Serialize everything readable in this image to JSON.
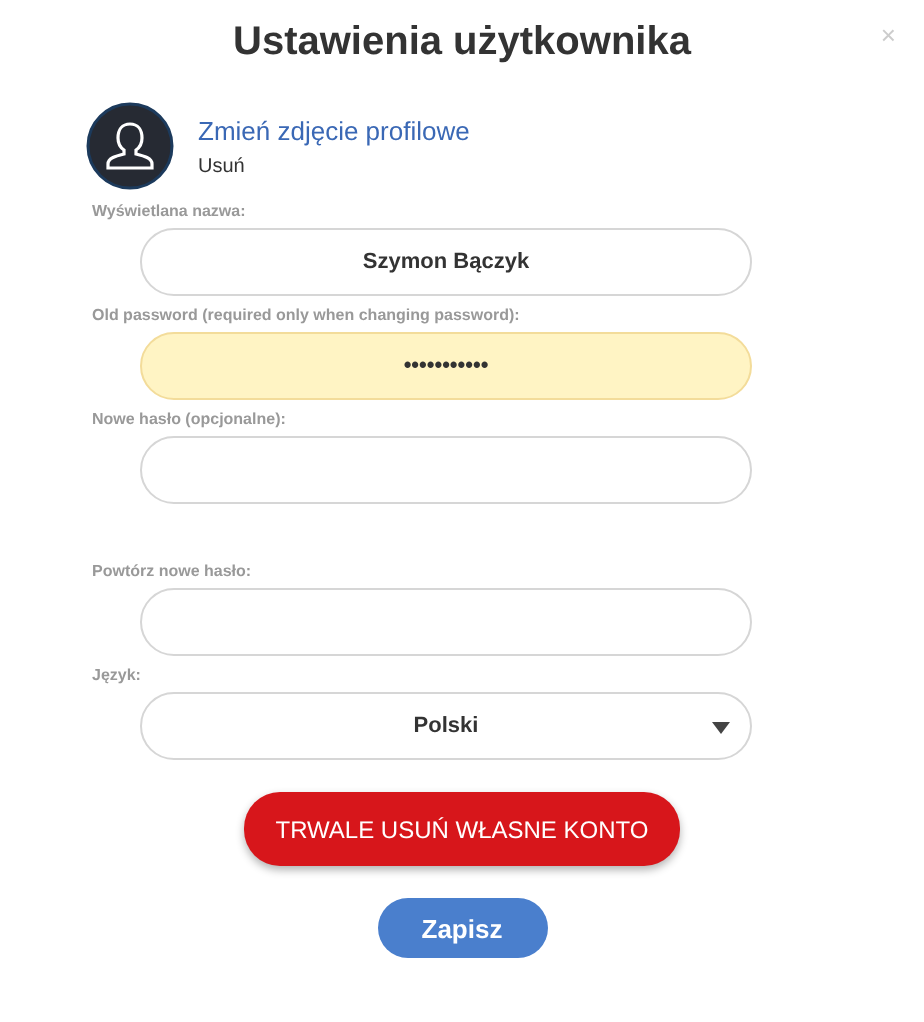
{
  "dialog": {
    "title": "Ustawienia użytkownika",
    "close": "×"
  },
  "profile": {
    "change_photo": "Zmień zdjęcie profilowe",
    "remove": "Usuń"
  },
  "fields": [
    {
      "kind": "text",
      "label": "Wyświetlana nazwa:",
      "value": "Szymon Bączyk",
      "autofilled": false
    },
    {
      "kind": "text",
      "label": "Old password (required only when changing password):",
      "value": "•••••••••••",
      "autofilled": true
    },
    {
      "kind": "text",
      "label": "Nowe hasło (opcjonalne):",
      "autofilled": false
    },
    {
      "kind": "text",
      "label": "Powtórz nowe hasło:",
      "autofilled": false
    },
    {
      "kind": "select",
      "label": "Język:",
      "value": "Polski"
    }
  ],
  "buttons": [
    {
      "kind": "danger",
      "label": "TRWALE USUŃ WŁASNE KONTO"
    },
    {
      "kind": "primary",
      "label": "Zapisz"
    }
  ]
}
